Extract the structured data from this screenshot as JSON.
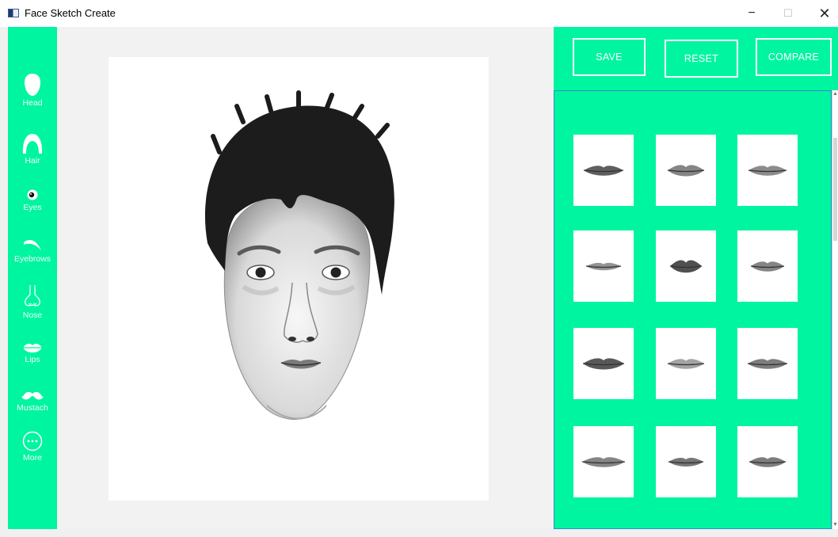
{
  "window": {
    "title": "Face Sketch Create",
    "minimize": "−",
    "maximize": "☐",
    "close": "✕"
  },
  "sidebar": {
    "items": [
      {
        "label": "Head",
        "icon": "head-icon"
      },
      {
        "label": "Hair",
        "icon": "hair-icon"
      },
      {
        "label": "Eyes",
        "icon": "eye-icon"
      },
      {
        "label": "Eyebrows",
        "icon": "eyebrow-icon"
      },
      {
        "label": "Nose",
        "icon": "nose-icon"
      },
      {
        "label": "Lips",
        "icon": "lips-icon"
      },
      {
        "label": "Mustach",
        "icon": "mustache-icon"
      },
      {
        "label": "More",
        "icon": "more-icon"
      }
    ]
  },
  "toolbar": {
    "save_label": "SAVE",
    "reset_label": "RESET",
    "compare_label": "COMPARE"
  },
  "gallery": {
    "category": "Lips",
    "items": [
      "lips-01",
      "lips-02",
      "lips-03",
      "lips-04",
      "lips-05",
      "lips-06",
      "lips-07",
      "lips-08",
      "lips-09",
      "lips-10",
      "lips-11",
      "lips-12"
    ]
  },
  "colors": {
    "accent": "#00f5a0",
    "panel_border": "#2a8fd0",
    "canvas_bg": "#f2f2f2"
  }
}
